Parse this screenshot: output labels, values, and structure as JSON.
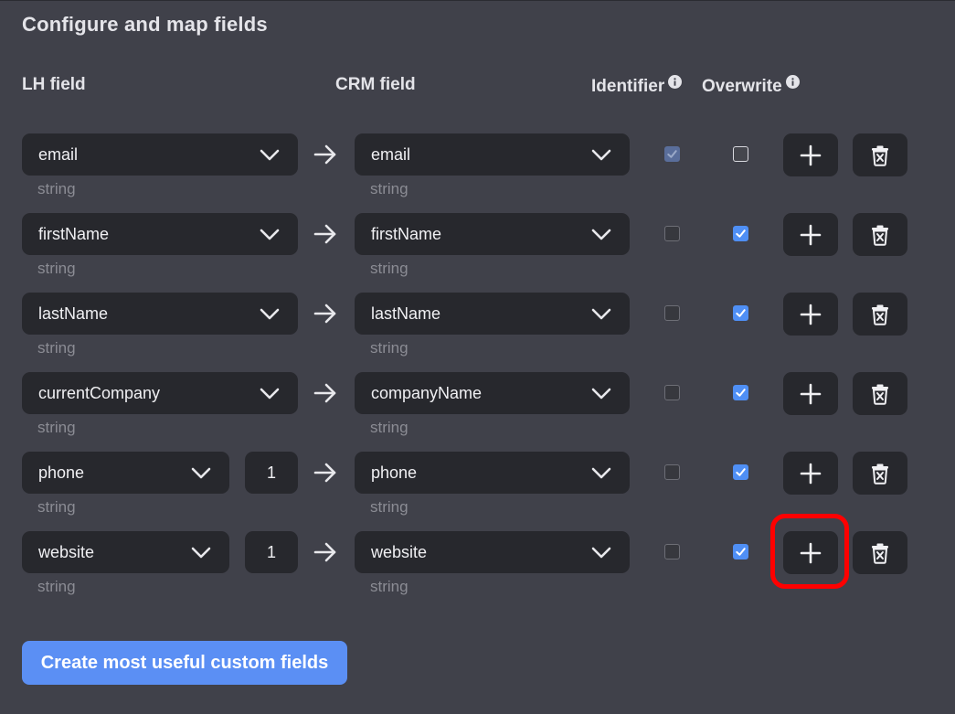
{
  "title": "Configure and map fields",
  "headers": {
    "lh_field": "LH field",
    "crm_field": "CRM field",
    "identifier": "Identifier",
    "overwrite": "Overwrite"
  },
  "icons": {
    "info": "info-icon",
    "chevron": "chevron-down-icon",
    "arrow": "arrow-right-icon",
    "add": "plus-icon",
    "delete": "trash-icon"
  },
  "colors": {
    "background": "#40414a",
    "control": "#27282d",
    "accent": "#5b8ff4",
    "checkbox": "#4f8ff5",
    "highlight": "#ff0000"
  },
  "rows": [
    {
      "lh": "email",
      "lh_type": "string",
      "index": null,
      "crm": "email",
      "crm_type": "string",
      "identifier": true,
      "overwrite": false
    },
    {
      "lh": "firstName",
      "lh_type": "string",
      "index": null,
      "crm": "firstName",
      "crm_type": "string",
      "identifier": false,
      "overwrite": true
    },
    {
      "lh": "lastName",
      "lh_type": "string",
      "index": null,
      "crm": "lastName",
      "crm_type": "string",
      "identifier": false,
      "overwrite": true
    },
    {
      "lh": "currentCompany",
      "lh_type": "string",
      "index": null,
      "crm": "companyName",
      "crm_type": "string",
      "identifier": false,
      "overwrite": true
    },
    {
      "lh": "phone",
      "lh_type": "string",
      "index": "1",
      "crm": "phone",
      "crm_type": "string",
      "identifier": false,
      "overwrite": true
    },
    {
      "lh": "website",
      "lh_type": "string",
      "index": "1",
      "crm": "website",
      "crm_type": "string",
      "identifier": false,
      "overwrite": true
    }
  ],
  "cta_label": "Create most useful custom fields"
}
